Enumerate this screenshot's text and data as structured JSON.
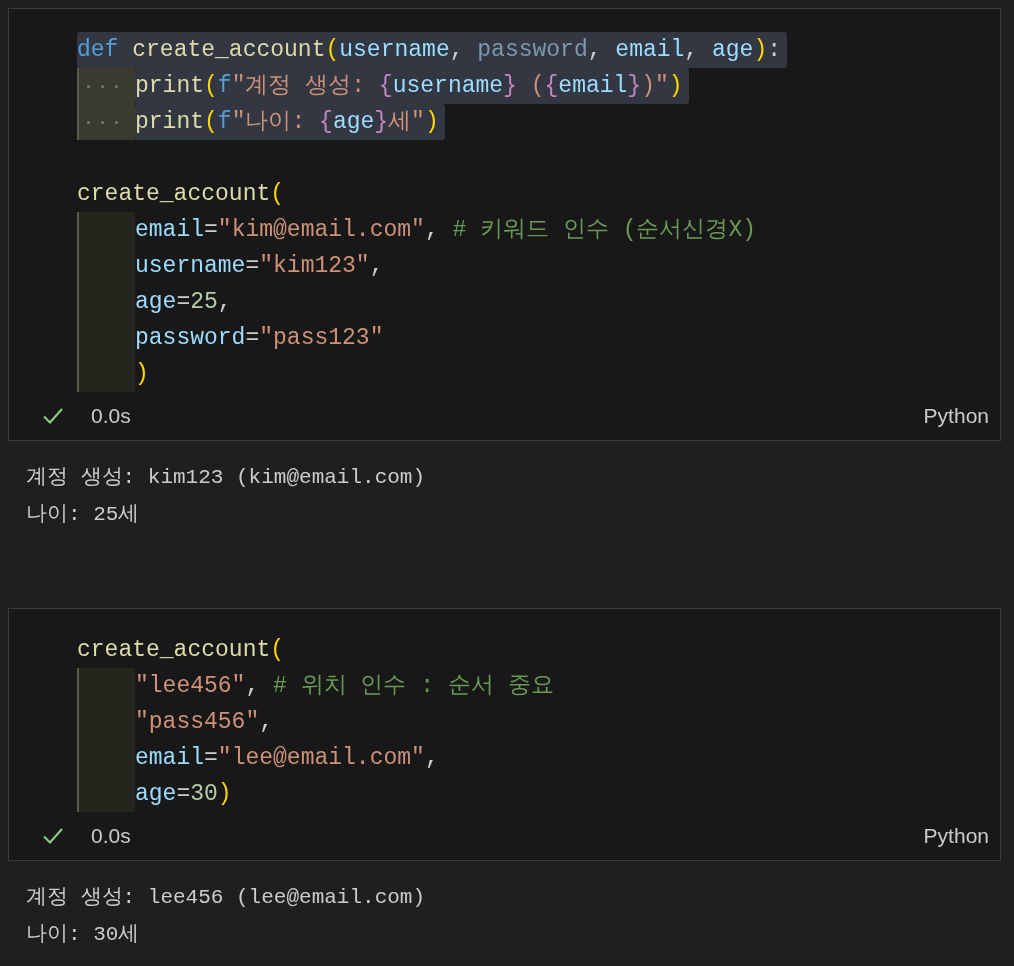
{
  "cells": [
    {
      "code": [
        {
          "lines": [
            {
              "selected": true,
              "indented": false,
              "tokens": [
                {
                  "text": "def ",
                  "kind": "keyword"
                },
                {
                  "text": "create_account",
                  "kind": "function"
                },
                {
                  "text": "(",
                  "kind": "paren"
                },
                {
                  "text": "username",
                  "kind": "param"
                },
                {
                  "text": ", ",
                  "kind": "punct"
                },
                {
                  "text": "password",
                  "kind": "unused"
                },
                {
                  "text": ", ",
                  "kind": "punct"
                },
                {
                  "text": "email",
                  "kind": "param"
                },
                {
                  "text": ", ",
                  "kind": "punct"
                },
                {
                  "text": "age",
                  "kind": "param"
                },
                {
                  "text": ")",
                  "kind": "paren"
                },
                {
                  "text": ":",
                  "kind": "punct"
                }
              ]
            },
            {
              "selected": true,
              "indented": true,
              "tokens": [
                {
                  "text": "print",
                  "kind": "function"
                },
                {
                  "text": "(",
                  "kind": "paren"
                },
                {
                  "text": "f",
                  "kind": "keyword"
                },
                {
                  "text": "\"계정 생성: ",
                  "kind": "string"
                },
                {
                  "text": "{",
                  "kind": "brace"
                },
                {
                  "text": "username",
                  "kind": "param"
                },
                {
                  "text": "}",
                  "kind": "brace"
                },
                {
                  "text": " (",
                  "kind": "string"
                },
                {
                  "text": "{",
                  "kind": "brace"
                },
                {
                  "text": "email",
                  "kind": "param"
                },
                {
                  "text": "}",
                  "kind": "brace"
                },
                {
                  "text": ")\"",
                  "kind": "string"
                },
                {
                  "text": ")",
                  "kind": "paren"
                }
              ]
            },
            {
              "selected": true,
              "indented": true,
              "tokens": [
                {
                  "text": "print",
                  "kind": "function"
                },
                {
                  "text": "(",
                  "kind": "paren"
                },
                {
                  "text": "f",
                  "kind": "keyword"
                },
                {
                  "text": "\"나이: ",
                  "kind": "string"
                },
                {
                  "text": "{",
                  "kind": "brace"
                },
                {
                  "text": "age",
                  "kind": "param"
                },
                {
                  "text": "}",
                  "kind": "brace"
                },
                {
                  "text": "세\"",
                  "kind": "string"
                },
                {
                  "text": ")",
                  "kind": "paren"
                }
              ]
            }
          ]
        },
        {
          "lines": [
            {
              "selected": false,
              "indented": false,
              "tokens": [
                {
                  "text": "create_account",
                  "kind": "function"
                },
                {
                  "text": "(",
                  "kind": "paren"
                }
              ]
            },
            {
              "selected": false,
              "indented": true,
              "tokens": [
                {
                  "text": "email",
                  "kind": "param"
                },
                {
                  "text": "=",
                  "kind": "punct"
                },
                {
                  "text": "\"kim@email.com\"",
                  "kind": "string"
                },
                {
                  "text": ", ",
                  "kind": "punct"
                },
                {
                  "text": "# 키워드 인수 (순서신경X)",
                  "kind": "comment"
                }
              ]
            },
            {
              "selected": false,
              "indented": true,
              "tokens": [
                {
                  "text": "username",
                  "kind": "param"
                },
                {
                  "text": "=",
                  "kind": "punct"
                },
                {
                  "text": "\"kim123\"",
                  "kind": "string"
                },
                {
                  "text": ",",
                  "kind": "punct"
                }
              ]
            },
            {
              "selected": false,
              "indented": true,
              "tokens": [
                {
                  "text": "age",
                  "kind": "param"
                },
                {
                  "text": "=",
                  "kind": "punct"
                },
                {
                  "text": "25",
                  "kind": "number"
                },
                {
                  "text": ",",
                  "kind": "punct"
                }
              ]
            },
            {
              "selected": false,
              "indented": true,
              "tokens": [
                {
                  "text": "password",
                  "kind": "param"
                },
                {
                  "text": "=",
                  "kind": "punct"
                },
                {
                  "text": "\"pass123\"",
                  "kind": "string"
                }
              ]
            },
            {
              "selected": false,
              "indented": true,
              "tokens": [
                {
                  "text": ")",
                  "kind": "paren"
                }
              ]
            }
          ]
        }
      ],
      "status": {
        "success": true,
        "duration": "0.0s",
        "language": "Python"
      },
      "output": [
        "계정 생성: kim123 (kim@email.com)",
        "나이: 25세"
      ]
    },
    {
      "code": [
        {
          "lines": [
            {
              "selected": false,
              "indented": false,
              "tokens": [
                {
                  "text": "create_account",
                  "kind": "function"
                },
                {
                  "text": "(",
                  "kind": "paren"
                }
              ]
            },
            {
              "selected": false,
              "indented": true,
              "tokens": [
                {
                  "text": "\"lee456\"",
                  "kind": "string"
                },
                {
                  "text": ", ",
                  "kind": "punct"
                },
                {
                  "text": "# 위치 인수 : 순서 중요",
                  "kind": "comment"
                }
              ]
            },
            {
              "selected": false,
              "indented": true,
              "tokens": [
                {
                  "text": "\"pass456\"",
                  "kind": "string"
                },
                {
                  "text": ",",
                  "kind": "punct"
                }
              ]
            },
            {
              "selected": false,
              "indented": true,
              "tokens": [
                {
                  "text": "email",
                  "kind": "param"
                },
                {
                  "text": "=",
                  "kind": "punct"
                },
                {
                  "text": "\"lee@email.com\"",
                  "kind": "string"
                },
                {
                  "text": ",",
                  "kind": "punct"
                }
              ]
            },
            {
              "selected": false,
              "indented": true,
              "tokens": [
                {
                  "text": "age",
                  "kind": "param"
                },
                {
                  "text": "=",
                  "kind": "punct"
                },
                {
                  "text": "30",
                  "kind": "number"
                },
                {
                  "text": ")",
                  "kind": "paren"
                }
              ]
            }
          ]
        }
      ],
      "status": {
        "success": true,
        "duration": "0.0s",
        "language": "Python"
      },
      "output": [
        "계정 생성: lee456 (lee@email.com)",
        "나이: 30세"
      ]
    }
  ]
}
